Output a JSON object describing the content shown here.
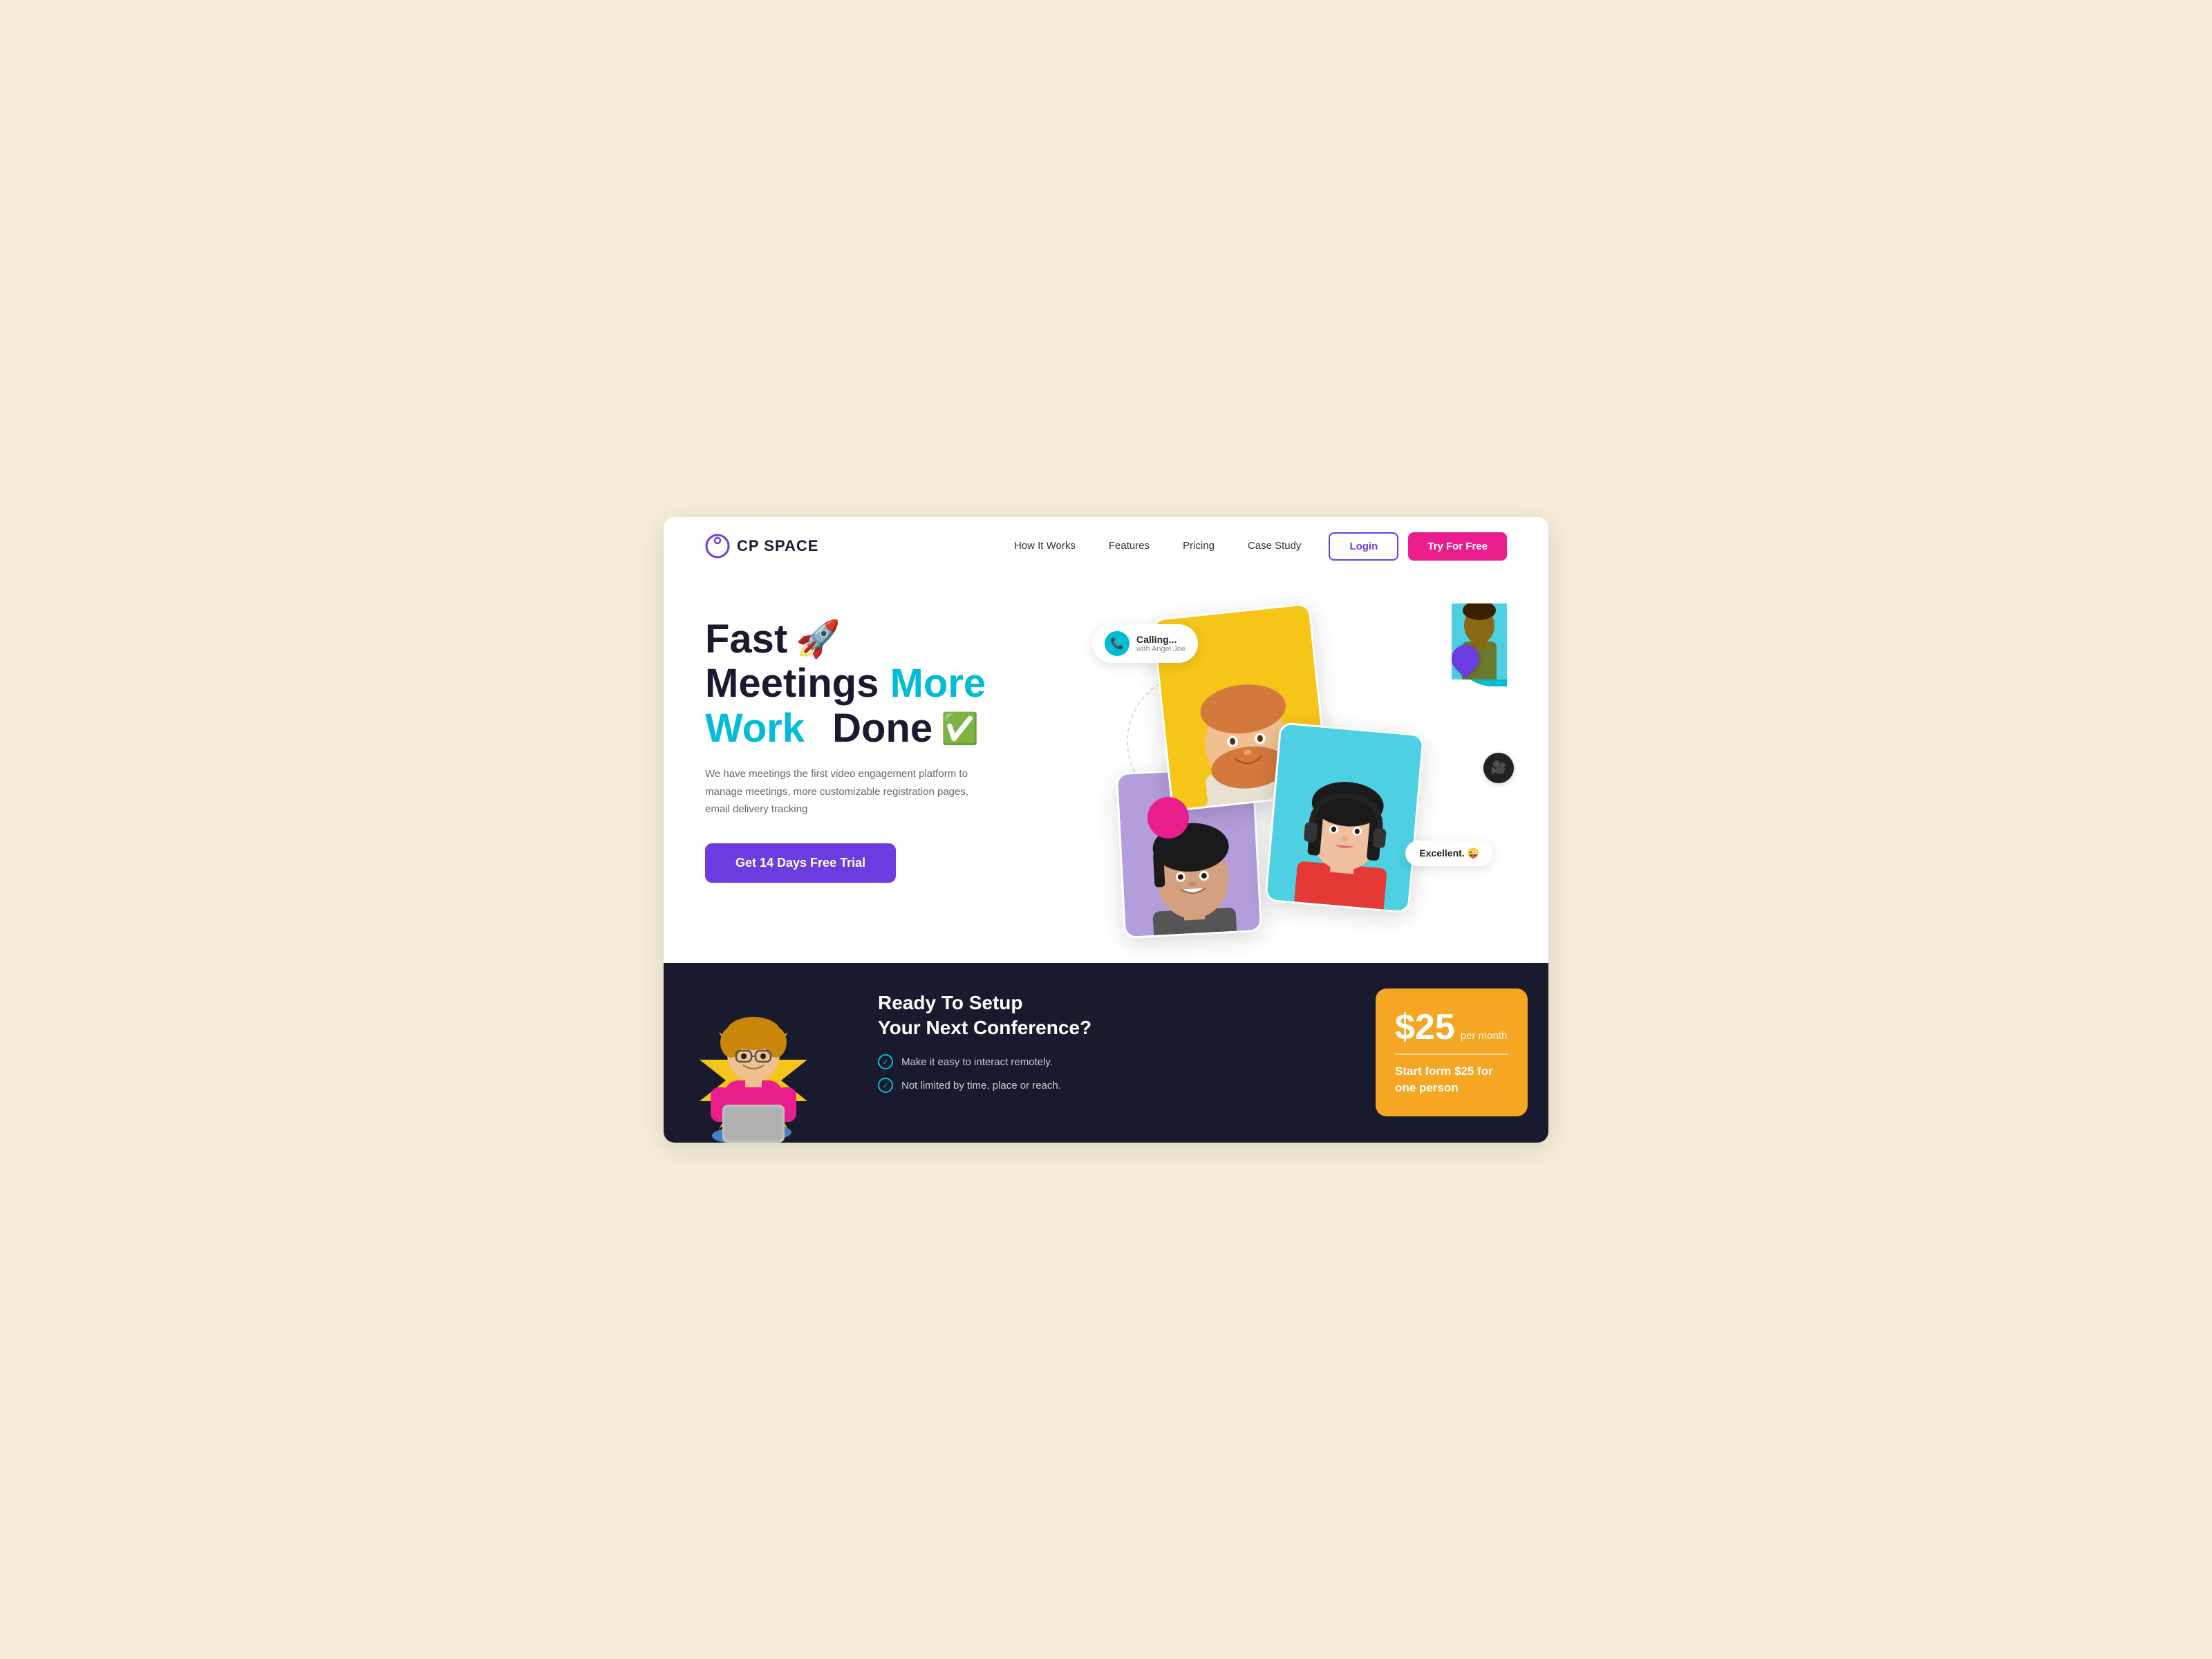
{
  "site": {
    "name": "CP SPACE",
    "logo_alt": "CP Space Logo"
  },
  "nav": {
    "links": [
      {
        "id": "how-it-works",
        "label": "How It Works"
      },
      {
        "id": "features",
        "label": "Features"
      },
      {
        "id": "pricing",
        "label": "Pricing"
      },
      {
        "id": "case-study",
        "label": "Case Study"
      }
    ],
    "login_label": "Login",
    "try_label": "Try For Free"
  },
  "hero": {
    "title_line1": "Fast",
    "title_line2": "Meetings More",
    "title_line3": "Work Done",
    "title_cyan": "More",
    "title_cyan2": "Work",
    "description": "We have meetings the first video engagement platform to manage meetings, more customizable registration pages, email delivery tracking",
    "cta_label": "Get 14 Days Free Trial",
    "rocket_emoji": "🚀",
    "badge_emoji": "✅",
    "calling_label": "Calling...",
    "calling_sub": "with Angel Joe",
    "excellent_label": "Excellent. 😜"
  },
  "bottom": {
    "title_line1": "Ready To Setup",
    "title_line2": "Your Next Conference?",
    "checklist": [
      "Make it easy to interact remotely.",
      "Not limited by time, place or reach."
    ],
    "pricing": {
      "amount": "$25",
      "period": "per month",
      "desc": "Start form $25 for one person"
    }
  },
  "icons": {
    "phone": "📞",
    "check": "✓",
    "camera": "📷"
  }
}
